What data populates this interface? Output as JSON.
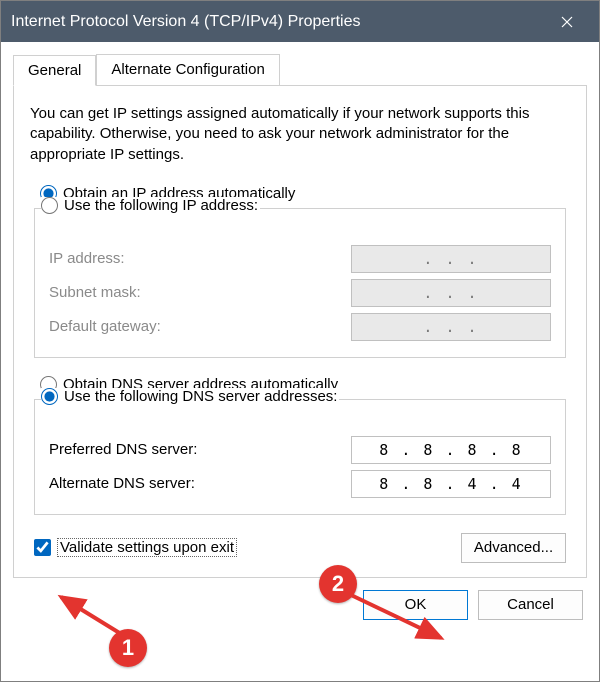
{
  "window": {
    "title": "Internet Protocol Version 4 (TCP/IPv4) Properties"
  },
  "tabs": {
    "general": "General",
    "alternate": "Alternate Configuration"
  },
  "description": "You can get IP settings assigned automatically if your network supports this capability. Otherwise, you need to ask your network administrator for the appropriate IP settings.",
  "ip_section": {
    "auto_label": "Obtain an IP address automatically",
    "manual_label": "Use the following IP address:",
    "ip_label": "IP address:",
    "subnet_label": "Subnet mask:",
    "gateway_label": "Default gateway:",
    "ip_value": ".       .       .",
    "subnet_value": ".       .       .",
    "gateway_value": ".       .       ."
  },
  "dns_section": {
    "auto_label": "Obtain DNS server address automatically",
    "manual_label": "Use the following DNS server addresses:",
    "preferred_label": "Preferred DNS server:",
    "alternate_label": "Alternate DNS server:",
    "preferred_value": "8  .  8  .  8  .  8",
    "alternate_value": "8  .  8  .  4  .  4"
  },
  "validate_label": "Validate settings upon exit",
  "buttons": {
    "advanced": "Advanced...",
    "ok": "OK",
    "cancel": "Cancel"
  },
  "annotations": {
    "one": "1",
    "two": "2"
  }
}
